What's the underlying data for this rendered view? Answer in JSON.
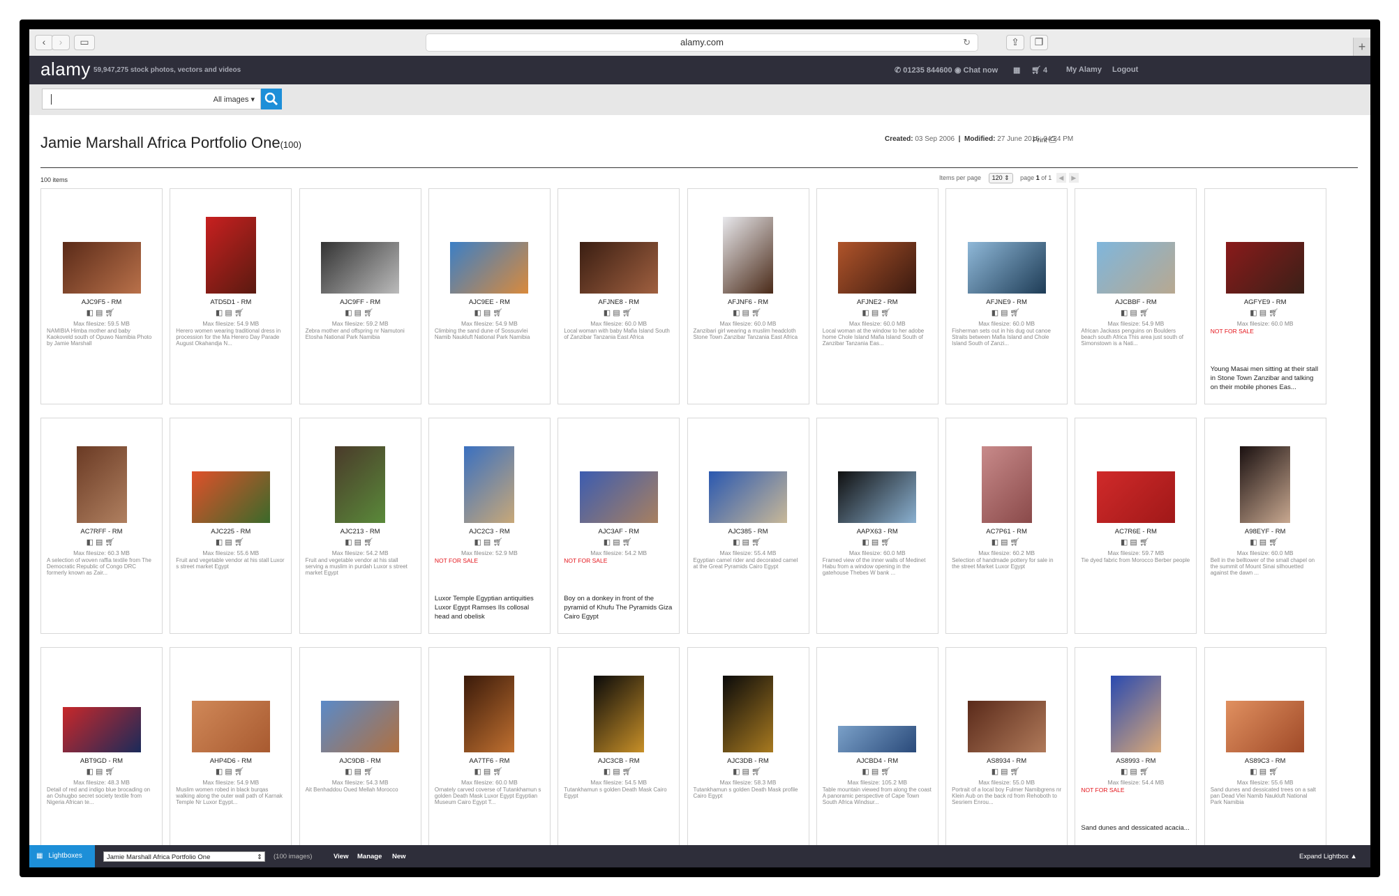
{
  "browser": {
    "url": "alamy.com"
  },
  "header": {
    "logo": "alamy",
    "tagline": "59,947,275  stock photos, vectors and videos",
    "phone": "01235 844600",
    "chat": "Chat now",
    "cart": "4",
    "my_alamy": "My Alamy",
    "logout": "Logout"
  },
  "search": {
    "placeholder": "",
    "value": "",
    "scope": "All images"
  },
  "page": {
    "title": "Jamie Marshall Africa Portfolio One",
    "count_suffix": "(100)",
    "created_label": "Created:",
    "created": "03 Sep 2006",
    "modified_label": "Modified:",
    "modified": "27 June 2015, 04:24 PM",
    "print": "Print",
    "items": "100 items",
    "items_per_page_label": "Items per page",
    "items_per_page": "120",
    "page_label": "page",
    "page_current": "1",
    "page_of": "of",
    "page_total": "1"
  },
  "items": [
    {
      "code": "AJC9F5 - RM",
      "size": "Max filesize: 59.5 MB",
      "desc": "NAMIBIA Himba mother and baby Kaokoveld south of Opuwo Namibia Photo by Jamie Marshall",
      "nfs": "",
      "desc2": "",
      "img": {
        "w": 112,
        "h": 74,
        "c1": "#5a2a18",
        "c2": "#b9714a"
      }
    },
    {
      "code": "ATD5D1 - RM",
      "size": "Max filesize: 54.9 MB",
      "desc": "Herero women wearing traditional dress in procession for the Ma Herero Day Parade August Okahandja N...",
      "nfs": "",
      "desc2": "",
      "img": {
        "w": 72,
        "h": 110,
        "c1": "#c82020",
        "c2": "#5a1a10"
      }
    },
    {
      "code": "AJC9FF - RM",
      "size": "Max filesize: 59.2 MB",
      "desc": "Zebra mother and offspring nr Namutoni Etosha National Park Namibia",
      "nfs": "",
      "desc2": "",
      "img": {
        "w": 112,
        "h": 74,
        "c1": "#333",
        "c2": "#bbb"
      }
    },
    {
      "code": "AJC9EE - RM",
      "size": "Max filesize: 54.9 MB",
      "desc": "Climbing the sand dune of Sossusvlei Namib Naukluft National Park Namibia",
      "nfs": "",
      "desc2": "",
      "img": {
        "w": 112,
        "h": 74,
        "c1": "#3b7fc6",
        "c2": "#d98a3c"
      }
    },
    {
      "code": "AFJNE8 - RM",
      "size": "Max filesize: 60.0 MB",
      "desc": "Local woman with baby Mafia Island South of Zanzibar Tanzania East Africa",
      "nfs": "",
      "desc2": "",
      "img": {
        "w": 112,
        "h": 74,
        "c1": "#3a1e12",
        "c2": "#a06040"
      }
    },
    {
      "code": "AFJNF6 - RM",
      "size": "Max filesize: 60.0 MB",
      "desc": "Zanzibari girl wearing a muslim headcloth Stone Town Zanzibar Tanzania East Africa",
      "nfs": "",
      "desc2": "",
      "img": {
        "w": 72,
        "h": 110,
        "c1": "#e8e8ec",
        "c2": "#4a2a18"
      }
    },
    {
      "code": "AFJNE2 - RM",
      "size": "Max filesize: 60.0 MB",
      "desc": "Local woman at the window to her adobe home Chole Island Mafia Island South of Zanzibar Tanzania Eas...",
      "nfs": "",
      "desc2": "",
      "img": {
        "w": 112,
        "h": 74,
        "c1": "#b0542a",
        "c2": "#3a1a10"
      }
    },
    {
      "code": "AFJNE9 - RM",
      "size": "Max filesize: 60.0 MB",
      "desc": "Fisherman sets out in his dug out canoe Straits between Mafia Island and Chole Island South of Zanzi...",
      "nfs": "",
      "desc2": "",
      "img": {
        "w": 112,
        "h": 74,
        "c1": "#8fb8d8",
        "c2": "#1e3c56"
      }
    },
    {
      "code": "AJCBBF - RM",
      "size": "Max filesize: 54.9 MB",
      "desc": "African Jackass penguins on Boulders beach south Africa This area just south of Simonstown is a Nati...",
      "nfs": "",
      "desc2": "",
      "img": {
        "w": 112,
        "h": 74,
        "c1": "#7fb6dc",
        "c2": "#b8a890"
      }
    },
    {
      "code": "AGFYE9 - RM",
      "size": "Max filesize: 60.0 MB",
      "desc": "",
      "nfs": "NOT FOR SALE",
      "desc2": "Young Masai men sitting at their stall in Stone Town Zanzibar and talking on their mobile phones Eas...",
      "img": {
        "w": 112,
        "h": 74,
        "c1": "#8a1a1a",
        "c2": "#3a2018"
      }
    },
    {
      "code": "AC7RFF - RM",
      "size": "Max filesize: 60.3 MB",
      "desc": "A selection of woven raffia textile from The Democratic Republic of Congo DRC formerly known as Zair...",
      "nfs": "",
      "desc2": "",
      "img": {
        "w": 72,
        "h": 110,
        "c1": "#6a3a24",
        "c2": "#b08060"
      }
    },
    {
      "code": "AJC225 - RM",
      "size": "Max filesize: 55.6 MB",
      "desc": "Fruit and vegetable vendor at his stall Luxor s street market Egypt",
      "nfs": "",
      "desc2": "",
      "img": {
        "w": 112,
        "h": 74,
        "c1": "#e0502a",
        "c2": "#3a6a2a"
      }
    },
    {
      "code": "AJC213 - RM",
      "size": "Max filesize: 54.2 MB",
      "desc": "Fruit and vegetable vendor at his stall serving a muslim in purdah Luxor s street market Egypt",
      "nfs": "",
      "desc2": "",
      "img": {
        "w": 72,
        "h": 110,
        "c1": "#4a3a2a",
        "c2": "#5a8a3a"
      }
    },
    {
      "code": "AJC2C3 - RM",
      "size": "Max filesize: 52.9 MB",
      "desc": "",
      "nfs": "NOT FOR SALE",
      "desc2": "Luxor Temple Egyptian antiquities Luxor Egypt Ramses IIs collosal head and obelisk",
      "img": {
        "w": 72,
        "h": 110,
        "c1": "#3a70c0",
        "c2": "#c8a878"
      }
    },
    {
      "code": "AJC3AF - RM",
      "size": "Max filesize: 54.2 MB",
      "desc": "",
      "nfs": "NOT FOR SALE",
      "desc2": "Boy on a donkey in front of the pyramid of Khufu The Pyramids Giza Cairo Egypt",
      "img": {
        "w": 112,
        "h": 74,
        "c1": "#3c5cb0",
        "c2": "#a88060"
      }
    },
    {
      "code": "AJC385 - RM",
      "size": "Max filesize: 55.4 MB",
      "desc": "Egyptian camel rider and decorated camel at the Great Pyramids Cairo Egypt",
      "nfs": "",
      "desc2": "",
      "img": {
        "w": 112,
        "h": 74,
        "c1": "#2a58b0",
        "c2": "#c8b898"
      }
    },
    {
      "code": "AAPX63 - RM",
      "size": "Max filesize: 60.0 MB",
      "desc": "Framed view of the inner walls of Medinet Habu from a window opening in the gatehouse Thebes W bank ...",
      "nfs": "",
      "desc2": "",
      "img": {
        "w": 112,
        "h": 74,
        "c1": "#101010",
        "c2": "#8ab0d0"
      }
    },
    {
      "code": "AC7P61 - RM",
      "size": "Max filesize: 60.2 MB",
      "desc": "Selection of handmade pottery for sale in the street Market Luxor Egypt",
      "nfs": "",
      "desc2": "",
      "img": {
        "w": 72,
        "h": 110,
        "c1": "#c88a8a",
        "c2": "#8a4a4a"
      }
    },
    {
      "code": "AC7R6E - RM",
      "size": "Max filesize: 59.7 MB",
      "desc": "Tie dyed fabric from Morocco Berber people",
      "nfs": "",
      "desc2": "",
      "img": {
        "w": 112,
        "h": 74,
        "c1": "#d02a2a",
        "c2": "#a01818"
      }
    },
    {
      "code": "A98EYF - RM",
      "size": "Max filesize: 60.0 MB",
      "desc": "Bell in the belltower of the small chapel on the summit of Mount Sinai silhouetted against the dawn ...",
      "nfs": "",
      "desc2": "",
      "img": {
        "w": 72,
        "h": 110,
        "c1": "#1a1010",
        "c2": "#c8a890"
      }
    },
    {
      "code": "ABT9GD - RM",
      "size": "Max filesize: 48.3 MB",
      "desc": "Detail of red and indigo blue brocading on an Oshugbo secret society textile from Nigeria African te...",
      "nfs": "",
      "desc2": "",
      "img": {
        "w": 112,
        "h": 65,
        "c1": "#c8282a",
        "c2": "#1a2a5a"
      }
    },
    {
      "code": "AHP4D6 - RM",
      "size": "Max filesize: 54.9 MB",
      "desc": "Muslim women robed in black burqas walking along the outer wall path of Karnak Temple Nr Luxor Egypt...",
      "nfs": "",
      "desc2": "",
      "img": {
        "w": 112,
        "h": 74,
        "c1": "#d08858",
        "c2": "#a85a30"
      }
    },
    {
      "code": "AJC9DB - RM",
      "size": "Max filesize: 54.3 MB",
      "desc": "Ait Benhaddou Oued Mellah Morocco",
      "nfs": "",
      "desc2": "",
      "img": {
        "w": 112,
        "h": 74,
        "c1": "#5a8ac8",
        "c2": "#b07040"
      }
    },
    {
      "code": "AA7TF6 - RM",
      "size": "Max filesize: 60.0 MB",
      "desc": "Ornately carved coverse of Tutankhamun s golden Death Mask Luxor Egypt Egyptian Museum Cairo Egypt T...",
      "nfs": "",
      "desc2": "",
      "img": {
        "w": 72,
        "h": 110,
        "c1": "#3a1a0a",
        "c2": "#c07030"
      }
    },
    {
      "code": "AJC3CB - RM",
      "size": "Max filesize: 54.5 MB",
      "desc": "Tutankhamun s golden Death Mask Cairo Egypt",
      "nfs": "",
      "desc2": "",
      "img": {
        "w": 72,
        "h": 110,
        "c1": "#0a0a0a",
        "c2": "#c89028"
      }
    },
    {
      "code": "AJC3DB - RM",
      "size": "Max filesize: 58.3 MB",
      "desc": "Tutankhamun s golden Death Mask profile Cairo Egypt",
      "nfs": "",
      "desc2": "",
      "img": {
        "w": 72,
        "h": 110,
        "c1": "#0a0a0a",
        "c2": "#a87a20"
      }
    },
    {
      "code": "AJCBD4 - RM",
      "size": "Max filesize: 105.2 MB",
      "desc": "Table mountain viewed from along the coast A panoramic perspective of Cape Town South Africa Windsur...",
      "nfs": "",
      "desc2": "",
      "img": {
        "w": 112,
        "h": 38,
        "c1": "#7aa0c8",
        "c2": "#2a4a7a"
      }
    },
    {
      "code": "AS8934 - RM",
      "size": "Max filesize: 55.0 MB",
      "desc": "Portrait of a local boy Fulmer Namibgrens nr Klein Aub on the back rd from Rehoboth to Sesriem Enrou...",
      "nfs": "",
      "desc2": "",
      "img": {
        "w": 112,
        "h": 74,
        "c1": "#5a2a1a",
        "c2": "#b07a5a"
      }
    },
    {
      "code": "AS8993 - RM",
      "size": "Max filesize: 54.4 MB",
      "desc": "",
      "nfs": "NOT FOR SALE",
      "desc2": "Sand dunes and dessicated acacia...",
      "img": {
        "w": 72,
        "h": 110,
        "c1": "#2a4ab0",
        "c2": "#d8a878"
      }
    },
    {
      "code": "AS89C3 - RM",
      "size": "Max filesize: 55.6 MB",
      "desc": "Sand dunes and dessicated trees on a salt pan Dead Vlei Namib Naukluft National Park Namibia",
      "nfs": "",
      "desc2": "",
      "img": {
        "w": 112,
        "h": 74,
        "c1": "#e09060",
        "c2": "#a04a28"
      }
    }
  ],
  "lightbox": {
    "button": "Lightboxes",
    "selected": "Jamie Marshall Africa Portfolio One",
    "images": "(100 images)",
    "view": "View",
    "manage": "Manage",
    "new": "New",
    "expand": "Expand Lightbox"
  }
}
